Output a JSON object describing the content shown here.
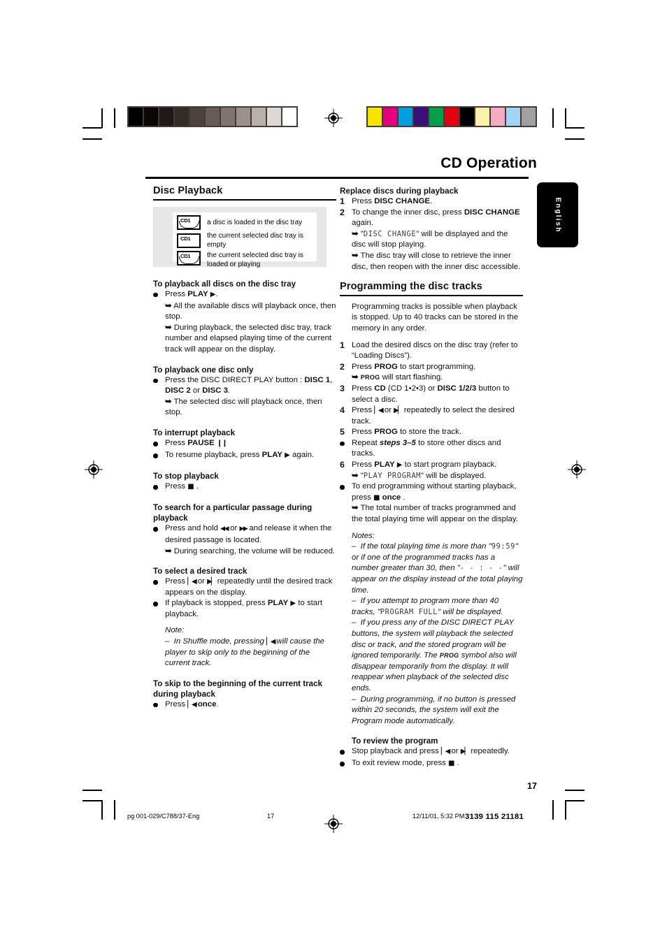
{
  "header": {
    "doc_title": "CD Operation",
    "language_tab": "English"
  },
  "printer_marks": {
    "grayscale_swatches": [
      "#000000",
      "#0b0707",
      "#1f1a17",
      "#332b26",
      "#4b423c",
      "#665c55",
      "#80756e",
      "#9b918a",
      "#b8b0aa",
      "#ddd8d3",
      "#ffffff"
    ],
    "color_swatches": [
      "#f5e400",
      "#e3007f",
      "#009fe3",
      "#3b1179",
      "#00a14b",
      "#e3000f",
      "#000000",
      "#faf0a8",
      "#f6aac4",
      "#9fd5f2",
      "#a0a0a0"
    ]
  },
  "legend": {
    "items": [
      {
        "icon": "disc-tray-loaded-icon",
        "icon_label": "CD1",
        "text": "a disc is loaded in the disc tray"
      },
      {
        "icon": "disc-tray-empty-icon",
        "icon_label": "CD1",
        "text": "the current selected disc tray is empty"
      },
      {
        "icon": "disc-tray-selected-icon",
        "icon_label": "CD1",
        "text": "the current selected disc tray is loaded or playing"
      }
    ]
  },
  "left_column": {
    "section_title": "Disc Playback",
    "blocks": [
      {
        "heading": "To playback all discs on the disc tray",
        "lines": [
          {
            "marker": "bullet",
            "text": "Press PLAY ▶."
          },
          {
            "marker": "arrow",
            "text": "All the available discs will playback once, then stop."
          },
          {
            "marker": "arrow",
            "text": "During playback, the selected disc tray, track number and elapsed playing time of the current track will appear on the display."
          }
        ]
      },
      {
        "heading": "To playback one disc only",
        "lines": [
          {
            "marker": "bullet",
            "text": "Press the DISC DIRECT PLAY button : DISC 1, DISC 2 or DISC 3."
          },
          {
            "marker": "arrow",
            "text": "The selected disc will playback once, then stop."
          }
        ]
      },
      {
        "heading": "To interrupt playback",
        "lines": [
          {
            "marker": "bullet",
            "text": "Press PAUSE ❙❙"
          },
          {
            "marker": "bullet",
            "text": "To resume playback, press PLAY ▶ again."
          }
        ]
      },
      {
        "heading": "To stop playback",
        "lines": [
          {
            "marker": "bullet",
            "text": "Press ■."
          }
        ]
      },
      {
        "heading": "To search for a particular passage during playback",
        "lines": [
          {
            "marker": "bullet",
            "text": "Press and hold ◀◀ or ▶▶ and release it when the desired passage is located."
          },
          {
            "marker": "arrow",
            "text": "During searching, the volume will be reduced."
          }
        ]
      },
      {
        "heading": "To select a desired track",
        "lines": [
          {
            "marker": "bullet",
            "text": "Press ▏◀ or ▶▏ repeatedly until the desired track appears on the display."
          },
          {
            "marker": "bullet",
            "text": "If playback is stopped, press PLAY ▶ to start playback."
          }
        ]
      },
      {
        "heading": "To skip to the beginning of the current track during playback",
        "lines": [
          {
            "marker": "bullet",
            "text": "Press ▏◀ once."
          }
        ]
      }
    ],
    "note": {
      "label": "Note:",
      "text": "–  In Shuffle mode, pressing ▏◀ will cause the player to skip only to the beginning of the current track."
    }
  },
  "right_column": {
    "replace_block": {
      "heading": "Replace discs during playback",
      "steps": [
        {
          "num": "1",
          "text": "Press DISC CHANGE."
        },
        {
          "num": "2",
          "text": "To change the inner disc, press DISC CHANGE again."
        }
      ],
      "arrows": [
        {
          "lcd": "DISC CHANGE",
          "text": "will be displayed and the disc will stop playing."
        },
        {
          "text": "The disc tray will close to retrieve the inner disc, then reopen with the inner disc accessible."
        }
      ]
    },
    "program_block": {
      "section_title": "Programming the disc tracks",
      "intro": "Programming tracks is possible when playback is stopped. Up to 40 tracks can be stored in the memory in any order.",
      "steps": [
        {
          "num": "1",
          "text": "Load the desired discs on the disc tray (refer to “Loading Discs”)."
        },
        {
          "num": "2",
          "text": "Press PROG to start programming."
        },
        {
          "num": "arrow",
          "text": "PROG will start flashing."
        },
        {
          "num": "3",
          "text": "Press CD (CD 1•2•3) or DISC 1/2/3 button to select a disc."
        },
        {
          "num": "4",
          "text": "Press ▏◀ or ▶▏ repeatedly to select the desired track."
        },
        {
          "num": "5",
          "text": "Press PROG to store the track."
        },
        {
          "num": "bullet",
          "text": "Repeat steps 3–5 to store other discs and tracks."
        },
        {
          "num": "6",
          "text": "Press PLAY ▶ to start program playback."
        },
        {
          "num": "arrow",
          "text": "“PLAY PROGRAM” will be displayed."
        },
        {
          "num": "bullet",
          "text": "To end programming without starting playback, press ■ once ."
        },
        {
          "num": "arrow",
          "text": "The total number of tracks programmed and the total playing time will appear on the display."
        }
      ]
    },
    "notes": {
      "label": "Notes:",
      "items": [
        "–  If the total playing time is more than \"99:59\" or if one of the programmed tracks has a number greater than 30, then \"- - : - -\" will appear on the display instead of the total playing time.",
        "–  If you attempt to program more than 40 tracks, \"PROGRAM FULL\" will be displayed.",
        "–  If you press any of the DISC DIRECT PLAY buttons, the system will playback the selected disc or track, and the stored program will be ignored temporarily. The PROG symbol also will disappear temporarily from the display. It will reappear when playback of the selected disc ends.",
        "–  During programming, if no button is pressed within 20 seconds, the system will exit the Program mode automatically."
      ]
    },
    "review_block": {
      "heading": "To review the program",
      "lines": [
        {
          "marker": "bullet",
          "text": "Stop playback and press ▏◀ or ▶▏ repeatedly."
        },
        {
          "marker": "bullet",
          "text": "To exit review mode, press ■ ."
        }
      ]
    }
  },
  "footer": {
    "page_number": "17",
    "file_label": "pg 001-029/C788/37-Eng",
    "sheet_number": "17",
    "timestamp": "12/11/01, 5:32 PM",
    "doc_code": "3139 115 21181"
  }
}
